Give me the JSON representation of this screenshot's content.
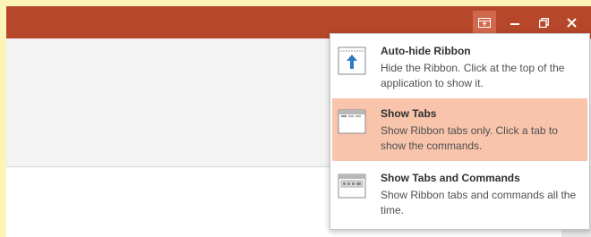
{
  "window_controls": {
    "ribbon_options_icon": "ribbon-display-options-icon",
    "minimize_icon": "minimize-icon",
    "restore_icon": "restore-icon",
    "close_icon": "close-icon"
  },
  "ribbon_menu": {
    "items": [
      {
        "icon": "auto-hide-ribbon-icon",
        "title": "Auto-hide Ribbon",
        "description": "Hide the Ribbon. Click at the top of the application to show it.",
        "highlighted": false
      },
      {
        "icon": "show-tabs-icon",
        "title": "Show Tabs",
        "description": "Show Ribbon tabs only. Click a tab to show the commands.",
        "highlighted": true
      },
      {
        "icon": "show-tabs-and-commands-icon",
        "title": "Show Tabs and Commands",
        "description": "Show Ribbon tabs and commands all the time.",
        "highlighted": false
      }
    ]
  },
  "colors": {
    "title_bar": "#b7472a",
    "highlight": "#f8c4ac",
    "outer_background": "#fdf5b8"
  }
}
